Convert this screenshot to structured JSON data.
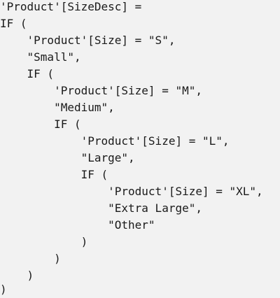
{
  "code": {
    "lines": [
      "'Product'[SizeDesc] =",
      "IF (",
      "    'Product'[Size] = \"S\",",
      "    \"Small\",",
      "    IF (",
      "        'Product'[Size] = \"M\",",
      "        \"Medium\",",
      "        IF (",
      "            'Product'[Size] = \"L\",",
      "            \"Large\",",
      "            IF (",
      "                'Product'[Size] = \"XL\",",
      "                \"Extra Large\",",
      "                \"Other\"",
      "            )",
      "        )",
      "    )",
      ")"
    ]
  }
}
